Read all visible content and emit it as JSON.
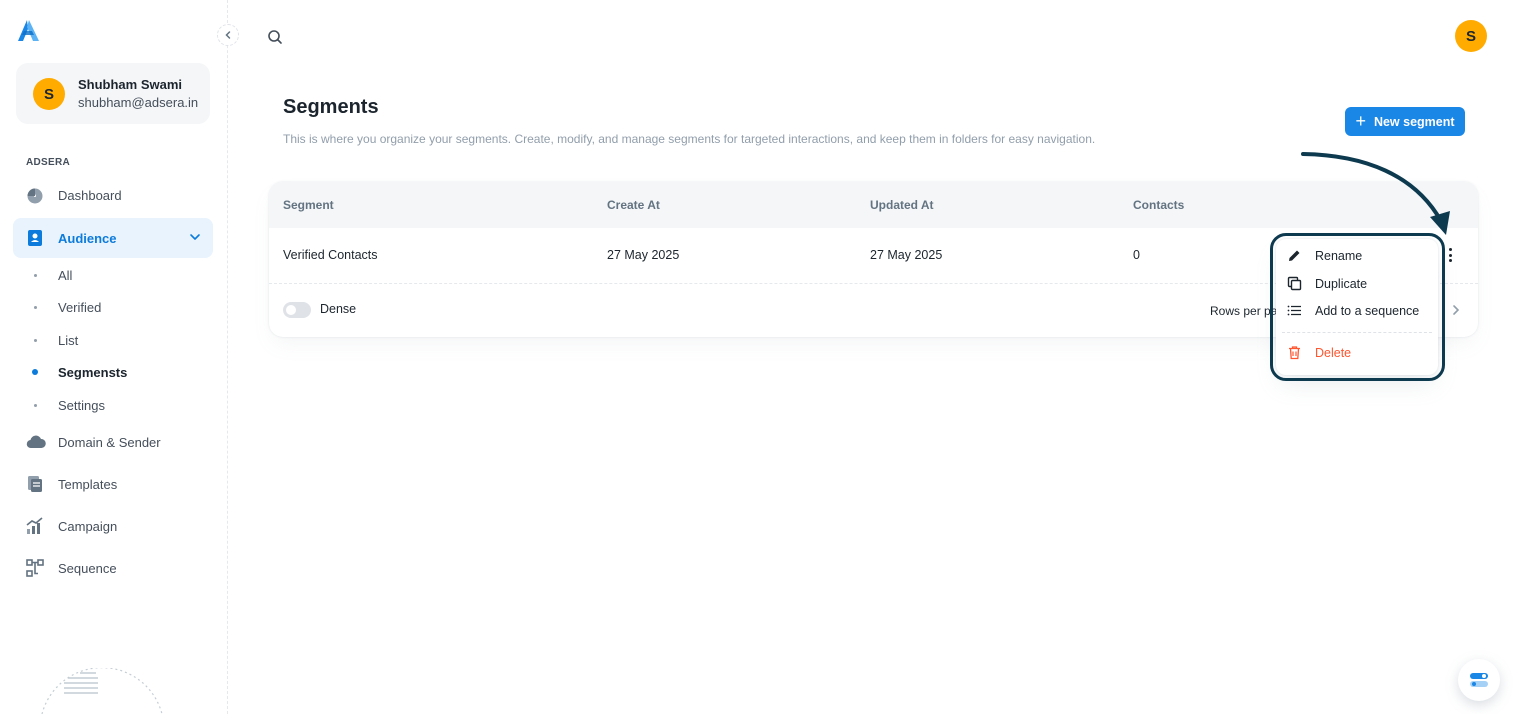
{
  "brand": {
    "logo_icon": "adsera-logo-icon",
    "accent": "#1a86e6"
  },
  "user": {
    "initial": "S",
    "name": "Shubham Swami",
    "email": "shubham@adsera.in"
  },
  "sidebar": {
    "section_label": "ADSERA",
    "items": [
      {
        "label": "Dashboard",
        "icon": "dashboard-gauge-icon"
      },
      {
        "label": "Audience",
        "icon": "audience-contact-icon",
        "active": true,
        "expanded": true
      },
      {
        "label": "Domain & Sender",
        "icon": "cloud-icon"
      },
      {
        "label": "Templates",
        "icon": "templates-icon"
      },
      {
        "label": "Campaign",
        "icon": "campaign-chart-icon"
      },
      {
        "label": "Sequence",
        "icon": "sequence-flow-icon"
      }
    ],
    "audience_sub": [
      {
        "label": "All"
      },
      {
        "label": "Verified"
      },
      {
        "label": "List"
      },
      {
        "label": "Segmensts",
        "active": true
      },
      {
        "label": "Settings"
      }
    ]
  },
  "header": {
    "avatar_initial": "S"
  },
  "page": {
    "title": "Segments",
    "description": "This is where you organize your segments. Create, modify, and manage segments for targeted interactions, and keep them in folders for easy navigation.",
    "new_button": "New segment"
  },
  "table": {
    "columns": [
      "Segment",
      "Create At",
      "Updated At",
      "Contacts"
    ],
    "rows": [
      {
        "segment": "Verified Contacts",
        "created": "27 May 2025",
        "updated": "27 May 2025",
        "contacts": "0"
      }
    ],
    "dense_label": "Dense",
    "dense_on": false,
    "rows_per_page_label": "Rows per pa"
  },
  "menu": {
    "items": [
      {
        "label": "Rename",
        "icon": "pencil-icon"
      },
      {
        "label": "Duplicate",
        "icon": "copy-icon"
      },
      {
        "label": "Add to a sequence",
        "icon": "list-icon"
      },
      {
        "label": "Delete",
        "icon": "trash-icon",
        "danger": true
      }
    ]
  },
  "colors": {
    "danger": "#ff5630",
    "highlight": "#0e3a4f",
    "avatar": "#ffab00"
  }
}
